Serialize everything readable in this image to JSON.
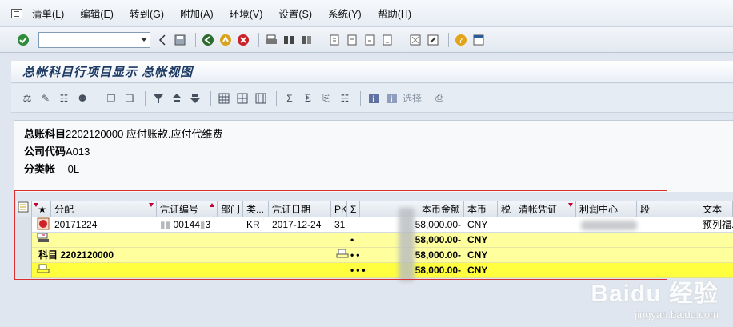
{
  "menubar": {
    "items": [
      "清单(L)",
      "编辑(E)",
      "转到(G)",
      "附加(A)",
      "环境(V)",
      "设置(S)",
      "系统(Y)",
      "帮助(H)"
    ]
  },
  "title": "总帐科目行项目显示 总帐视图",
  "appbar": {
    "select_label": "选择"
  },
  "header": {
    "account_label": "总账科目",
    "account_value": "2202120000 应付账款.应付代维费",
    "company_label": "公司代码",
    "company_value": "A013",
    "ledger_label": "分类帐",
    "ledger_value": "0L"
  },
  "grid": {
    "columns": [
      "分配",
      "凭证编号",
      "部门",
      "类...",
      "凭证日期",
      "PK",
      "Σ",
      "本币金额",
      "本币",
      "税",
      "清帐凭证",
      "利润中心",
      "段",
      "文本"
    ],
    "rows": [
      {
        "assignment": "20171224",
        "doc_no": "00144",
        "doc_no_tail": "3",
        "type": "KR",
        "date": "2017-12-24",
        "pk": "31",
        "amount": "58,000.00-",
        "currency": "CNY",
        "text": "预列福..."
      },
      {
        "amount": "58,000.00-",
        "currency": "CNY"
      },
      {
        "label": "科目 2202120000",
        "amount": "58,000.00-",
        "currency": "CNY"
      },
      {
        "amount": "58,000.00-",
        "currency": "CNY"
      }
    ]
  },
  "watermark": {
    "line1": "Baidu 经验",
    "line2": "jingyan.baidu.com"
  }
}
